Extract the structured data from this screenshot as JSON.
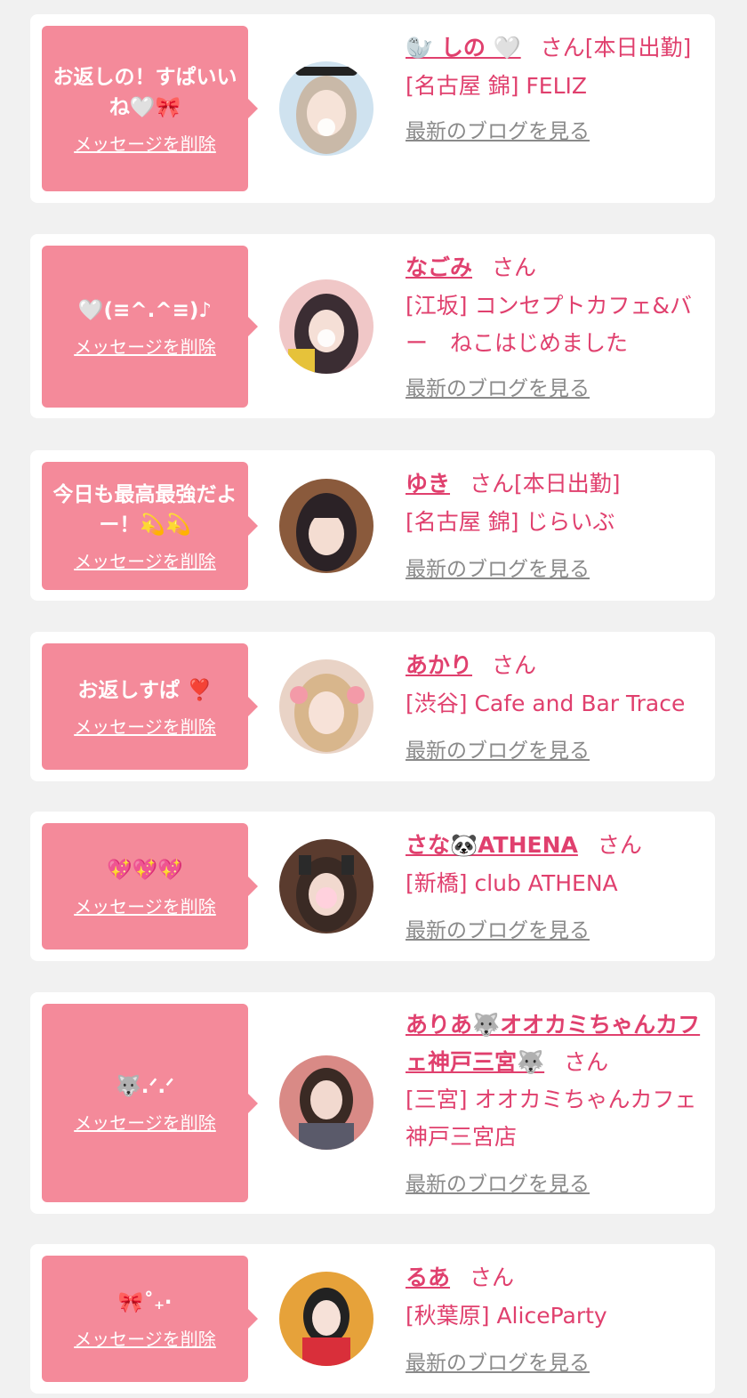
{
  "delete_label": "メッセージを削除",
  "blog_label": "最新のブログを見る",
  "colors": {
    "page_bg": "#f1f1f1",
    "card_bg": "#ffffff",
    "bubble_bg": "#f48a9a",
    "accent": "#e0406e",
    "muted": "#8a8a8a"
  },
  "cards": [
    {
      "message": "お返しの！すぱいいね🤍🎀",
      "name": "🦭 しの 🤍",
      "honorific": "さん",
      "status": "[本日出勤]",
      "shop": "[名古屋 錦] FELIZ"
    },
    {
      "message": "🤍(≡^.^≡)♪",
      "name": "なごみ",
      "honorific": "さん",
      "status": "",
      "shop": "[江坂] コンセプトカフェ&バー　ねこはじめました"
    },
    {
      "message": "今日も最高最強だよー！💫💫",
      "name": "ゆき",
      "honorific": "さん",
      "status": "[本日出勤]",
      "shop": "[名古屋 錦] じらいぶ"
    },
    {
      "message": "お返しすぱ ❣️",
      "name": "あかり",
      "honorific": "さん",
      "status": "",
      "shop": "[渋谷] Cafe and Bar Trace"
    },
    {
      "message": "💖💖💖",
      "name": "さな🐼ATHENA",
      "honorific": "さん",
      "status": "",
      "shop": "[新橋] club ATHENA"
    },
    {
      "message": "🐺.ᐟ.ᐟ",
      "name": "ありあ🐺オオカミちゃんカフェ神戸三宮🐺",
      "honorific": "さん",
      "status": "",
      "shop": "[三宮] オオカミちゃんカフェ神戸三宮店"
    },
    {
      "message": "🎀˚₊‧",
      "name": "るあ",
      "honorific": "さん",
      "status": "",
      "shop": "[秋葉原] AliceParty"
    }
  ]
}
